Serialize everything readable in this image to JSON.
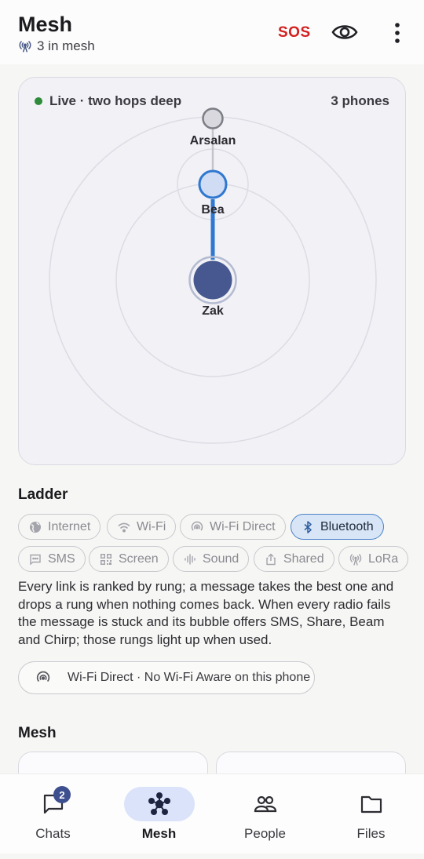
{
  "header": {
    "title": "Mesh",
    "subtitle": "3 in mesh",
    "sos_label": "SOS"
  },
  "map": {
    "live_text": "Live · two hops deep",
    "phones_text": "3 phones",
    "nodes": [
      {
        "name": "Arsalan"
      },
      {
        "name": "Bea"
      },
      {
        "name": "Zak"
      }
    ]
  },
  "ladder": {
    "title": "Ladder",
    "rungs": [
      {
        "label": "Internet",
        "icon": "globe-icon",
        "active": false
      },
      {
        "label": "Wi-Fi",
        "icon": "wifi-icon",
        "active": false
      },
      {
        "label": "Wi-Fi Direct",
        "icon": "wifi-direct-icon",
        "active": false
      },
      {
        "label": "Bluetooth",
        "icon": "bluetooth-icon",
        "active": true
      },
      {
        "label": "SMS",
        "icon": "sms-icon",
        "active": false
      },
      {
        "label": "Screen",
        "icon": "qr-code-icon",
        "active": false
      },
      {
        "label": "Sound",
        "icon": "sound-wave-icon",
        "active": false
      },
      {
        "label": "Shared",
        "icon": "share-icon",
        "active": false
      },
      {
        "label": "LoRa",
        "icon": "radio-tower-icon",
        "active": false
      }
    ],
    "description": "Every link is ranked by rung; a message takes the best one and drops a rung when nothing comes back. When every radio fails the message is stuck and its bubble offers SMS, Share, Beam and Chirp; those rungs light up when used.",
    "status": "Wi-Fi Direct · No Wi-Fi Aware on this phone"
  },
  "mesh_section": {
    "title": "Mesh"
  },
  "nav": {
    "items": [
      {
        "label": "Chats",
        "icon": "chat-icon",
        "badge": "2",
        "active": false
      },
      {
        "label": "Mesh",
        "icon": "mesh-network-icon",
        "active": true
      },
      {
        "label": "People",
        "icon": "people-icon",
        "active": false
      },
      {
        "label": "Files",
        "icon": "folder-icon",
        "active": false
      }
    ]
  },
  "colors": {
    "accent": "#2f77d0",
    "sos": "#d32020",
    "live": "#2e8b3a",
    "self_node": "#46588f"
  }
}
